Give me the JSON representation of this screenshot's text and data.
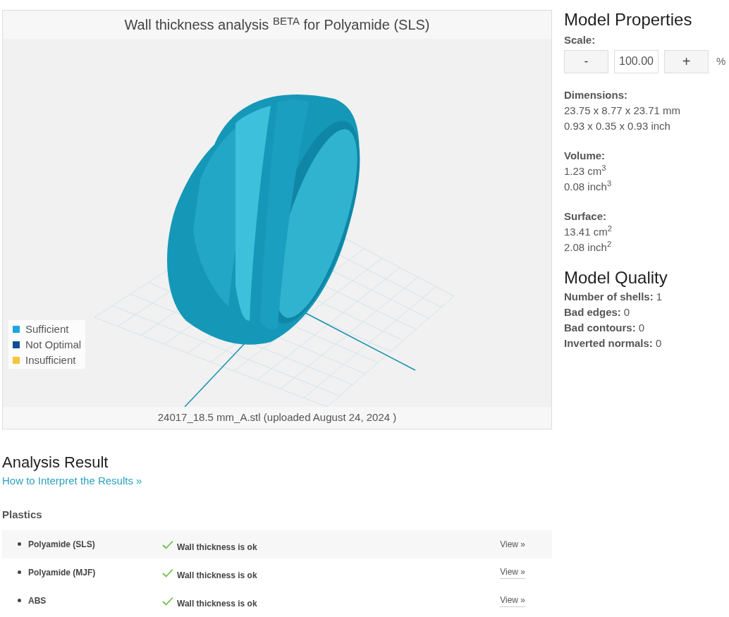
{
  "viewer": {
    "title": "Wall thickness analysis $^{BETA}$ for Polyamide (SLS)",
    "legend": [
      {
        "label": "Sufficient",
        "color": "#1aa7e0"
      },
      {
        "label": "Not Optimal",
        "color": "#0d4f91"
      },
      {
        "label": "Insufficient",
        "color": "#f5c53c"
      }
    ],
    "file_caption": "24017_18.5 mm_A.stl (uploaded August 24, 2024 )"
  },
  "model_properties": {
    "heading": "Model Properties",
    "scale": {
      "label": "Scale:",
      "minus": "-",
      "value": "100.00",
      "plus": "+",
      "unit": "%"
    },
    "groups": [
      {
        "label": "Dimensions:",
        "lines": [
          "23.75 x 8.77 x 23.71 mm",
          "0.93 x 0.35 x 0.93 inch"
        ]
      },
      {
        "label": "Volume:",
        "lines": [
          "1.23 cm$^{3}$",
          "0.08 inch$^{3}$"
        ]
      },
      {
        "label": "Surface:",
        "lines": [
          "13.41 cm$^{2}$",
          "2.08 inch$^{2}$"
        ]
      }
    ]
  },
  "model_quality": {
    "heading": "Model Quality",
    "items": [
      {
        "label": "Number of shells:",
        "value": "1"
      },
      {
        "label": "Bad edges:",
        "value": "0"
      },
      {
        "label": "Bad contours:",
        "value": "0"
      },
      {
        "label": "Inverted normals:",
        "value": "0"
      }
    ]
  },
  "analysis": {
    "heading": "Analysis Result",
    "help_link": "How to Interpret the Results »",
    "section": "Plastics",
    "rows": [
      {
        "material": "Polyamide (SLS)",
        "status": "Wall thickness is ok",
        "action": "View »",
        "selected": true
      },
      {
        "material": "Polyamide (MJF)",
        "status": "Wall thickness is ok",
        "action": "View »",
        "selected": false
      },
      {
        "material": "ABS",
        "status": "Wall thickness is ok",
        "action": "View »",
        "selected": false
      }
    ]
  }
}
